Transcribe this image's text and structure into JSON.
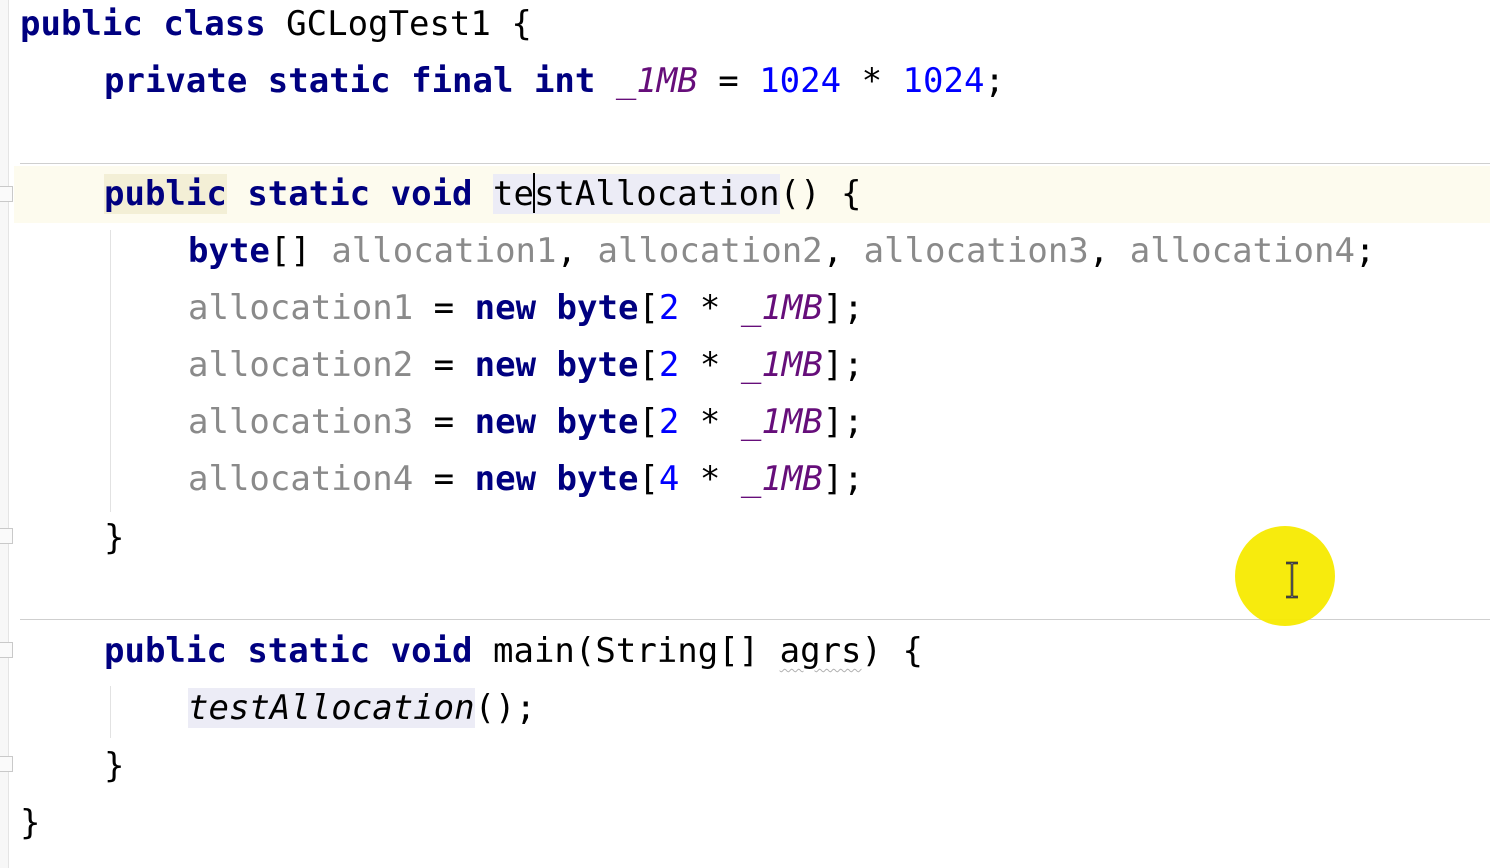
{
  "editor": {
    "lines": {
      "l1": {
        "kw1": "public",
        "kw2": "class",
        "name": "GCLogTest1",
        "brace": "{"
      },
      "l2": {
        "kw1": "private",
        "kw2": "static",
        "kw3": "final",
        "kw4": "int",
        "field": "_1MB",
        "eq": "=",
        "n1": "1024",
        "op": "*",
        "n2": "1024",
        "semi": ";"
      },
      "l3": {
        "kw1": "public",
        "kw2": "static",
        "kw3": "void",
        "name_a": "te",
        "name_b": "stAllocation",
        "parens": "()",
        "brace": "{"
      },
      "l4": {
        "kw": "byte",
        "brackets": "[]",
        "v1": "allocation1",
        "c1": ",",
        "v2": "allocation2",
        "c2": ",",
        "v3": "allocation3",
        "c3": ",",
        "v4": "allocation4",
        "semi": ";"
      },
      "l5": {
        "var": "allocation1",
        "eq": "=",
        "kw1": "new",
        "kw2": "byte",
        "open": "[",
        "n": "2",
        "op": "*",
        "field": "_1MB",
        "close": "];"
      },
      "l6": {
        "var": "allocation2",
        "eq": "=",
        "kw1": "new",
        "kw2": "byte",
        "open": "[",
        "n": "2",
        "op": "*",
        "field": "_1MB",
        "close": "];"
      },
      "l7": {
        "var": "allocation3",
        "eq": "=",
        "kw1": "new",
        "kw2": "byte",
        "open": "[",
        "n": "2",
        "op": "*",
        "field": "_1MB",
        "close": "];"
      },
      "l8": {
        "var": "allocation4",
        "eq": "=",
        "kw1": "new",
        "kw2": "byte",
        "open": "[",
        "n": "4",
        "op": "*",
        "field": "_1MB",
        "close": "];"
      },
      "l9": {
        "brace": "}"
      },
      "l10": {
        "kw1": "public",
        "kw2": "static",
        "kw3": "void",
        "name": "main",
        "open": "(",
        "type": "String[]",
        "param": "agrs",
        "close": ")",
        "brace": "{"
      },
      "l11": {
        "call": "testAllocation",
        "rest": "();"
      },
      "l12": {
        "brace": "}"
      },
      "l13": {
        "brace": "}"
      }
    },
    "colors": {
      "keyword": "#000080",
      "number": "#0000ff",
      "static_field": "#660e7a",
      "unused_variable": "#8a8a8a",
      "current_line": "#fdfbee",
      "cursor_highlight": "#f7ea00"
    },
    "mouse_cursor_icon": "i-beam-cursor-icon"
  }
}
